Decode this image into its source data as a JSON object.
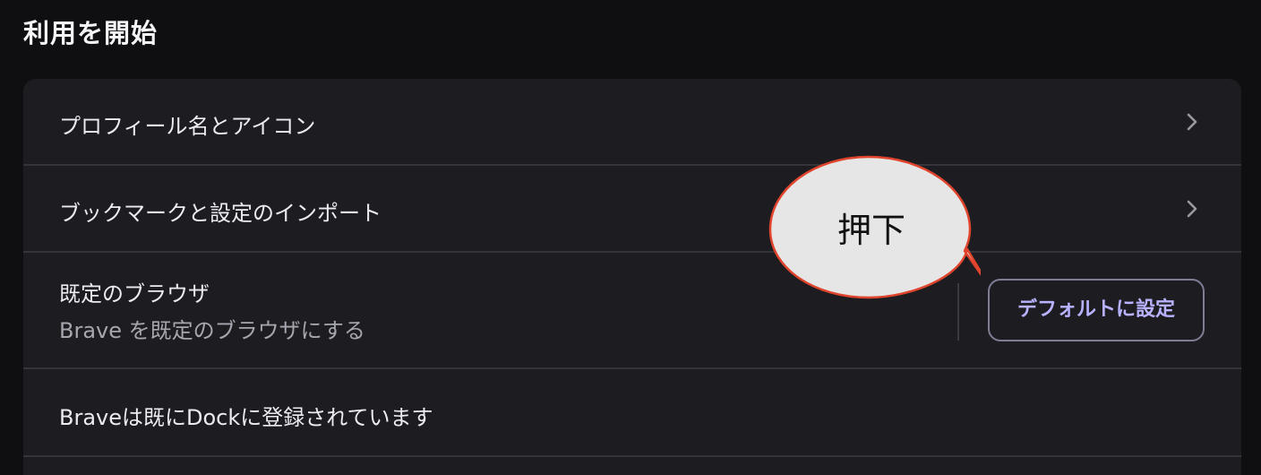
{
  "section": {
    "title": "利用を開始"
  },
  "rows": [
    {
      "label": "プロフィール名とアイコン",
      "chevron": "chevron-right-icon"
    },
    {
      "label": "ブックマークと設定のインポート",
      "chevron": "chevron-right-icon"
    },
    {
      "label": "既定のブラウザ",
      "sublabel": "Brave を既定のブラウザにする",
      "button_label": "デフォルトに設定"
    },
    {
      "label": "Braveは既にDockに登録されています"
    }
  ],
  "callout": {
    "text": "押下",
    "fill_color": "#e6e6e6",
    "stroke_color": "#e0442c"
  },
  "colors": {
    "background": "#0f0f11",
    "card": "#1d1d21",
    "accent_text": "#b9b3ff"
  }
}
